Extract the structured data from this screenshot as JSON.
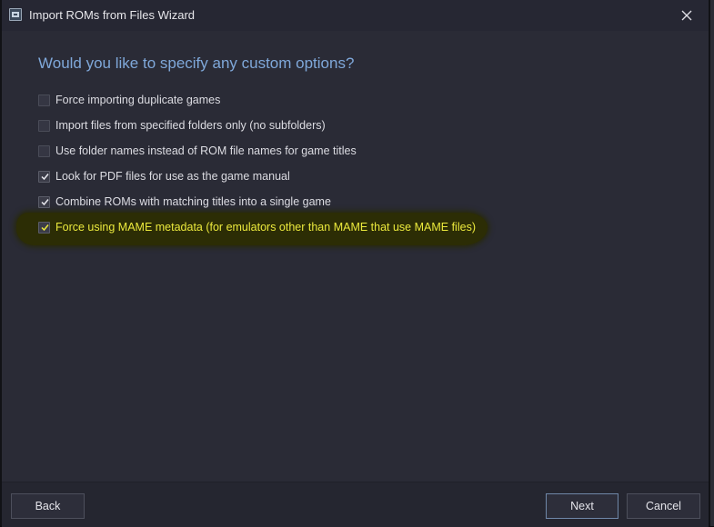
{
  "window": {
    "title": "Import ROMs from Files Wizard",
    "close_icon": "close-icon",
    "app_icon": "app-icon"
  },
  "page": {
    "heading": "Would you like to specify any custom options?"
  },
  "options": [
    {
      "label": "Force importing duplicate games",
      "checked": false
    },
    {
      "label": "Import files from specified folders only (no subfolders)",
      "checked": false
    },
    {
      "label": "Use folder names instead of ROM file names for game titles",
      "checked": false
    },
    {
      "label": "Look for PDF files for use as the game manual",
      "checked": true
    },
    {
      "label": "Combine ROMs with matching titles into a single game",
      "checked": true
    },
    {
      "label": "Force using MAME metadata (for emulators other than MAME that use MAME files)",
      "checked": true,
      "highlighted": true
    }
  ],
  "footer": {
    "back_label": "Back",
    "next_label": "Next",
    "cancel_label": "Cancel"
  },
  "colors": {
    "window_bg": "#2a2b36",
    "heading": "#7fa8da",
    "highlight_text": "#ebe93c",
    "highlight_bg": "#2c2d05"
  }
}
